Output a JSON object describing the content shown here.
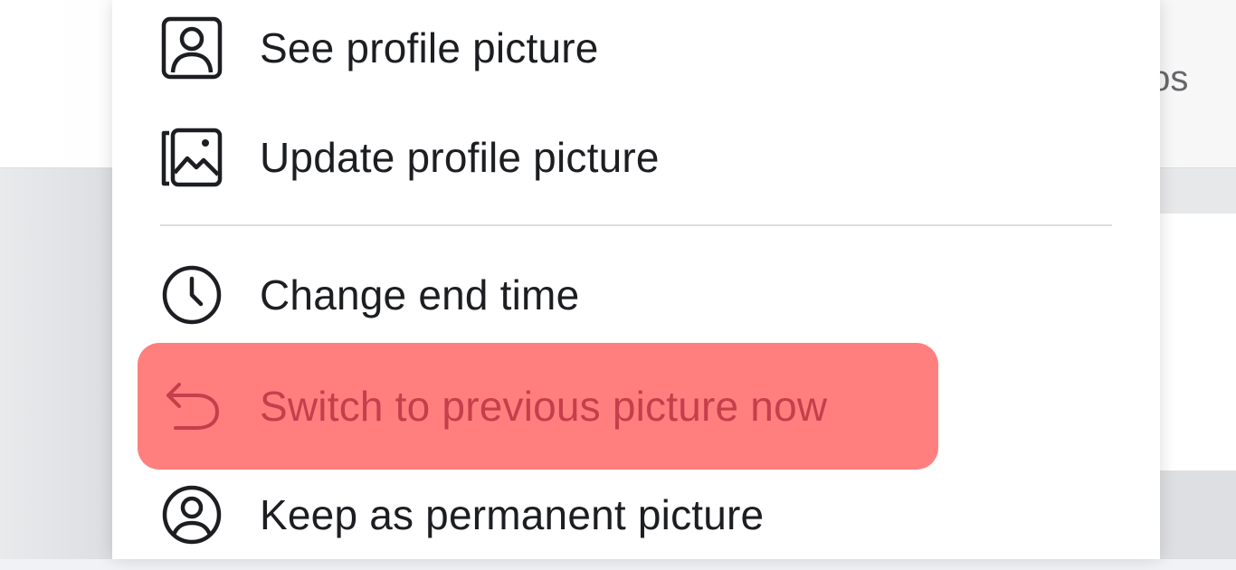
{
  "background": {
    "peek_text": "tos"
  },
  "menu": {
    "items": [
      {
        "label": "See profile picture",
        "icon": "user-portrait-icon"
      },
      {
        "label": "Update profile picture",
        "icon": "image-frame-icon"
      },
      {
        "label": "Change end time",
        "icon": "clock-icon"
      },
      {
        "label": "Switch to previous picture now",
        "icon": "undo-arrow-icon",
        "highlighted": true
      },
      {
        "label": "Keep as permanent picture",
        "icon": "user-circle-icon"
      }
    ]
  },
  "colors": {
    "highlight": "#ff7f7f",
    "highlight_text": "#c53f4b",
    "text": "#1c1e21",
    "icon": "#1c1e21"
  }
}
